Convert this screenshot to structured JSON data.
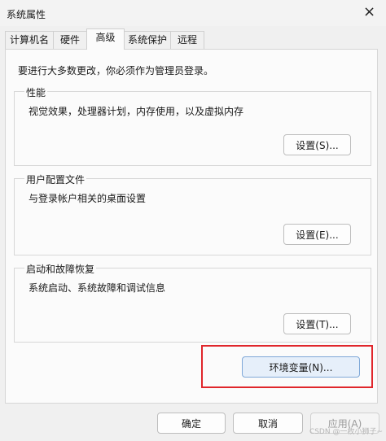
{
  "window": {
    "title": "系统属性",
    "close_glyph": "×"
  },
  "tabs": [
    {
      "label": "计算机名"
    },
    {
      "label": "硬件"
    },
    {
      "label": "高级"
    },
    {
      "label": "系统保护"
    },
    {
      "label": "远程"
    }
  ],
  "active_tab": "高级",
  "note": "要进行大多数更改，你必须作为管理员登录。",
  "performance": {
    "title": "性能",
    "description": "视觉效果，处理器计划，内存使用，以及虚拟内存",
    "button": "设置(S)..."
  },
  "user_profiles": {
    "title": "用户配置文件",
    "description": "与登录帐户相关的桌面设置",
    "button": "设置(E)..."
  },
  "startup_recovery": {
    "title": "启动和故障恢复",
    "description": "系统启动、系统故障和调试信息",
    "button": "设置(T)..."
  },
  "env_vars_button": "环境变量(N)...",
  "footer": {
    "ok": "确定",
    "cancel": "取消",
    "apply": "应用(A)"
  },
  "watermark": "CSDN @一枚小狮子~",
  "highlight_color": "#e0262b"
}
